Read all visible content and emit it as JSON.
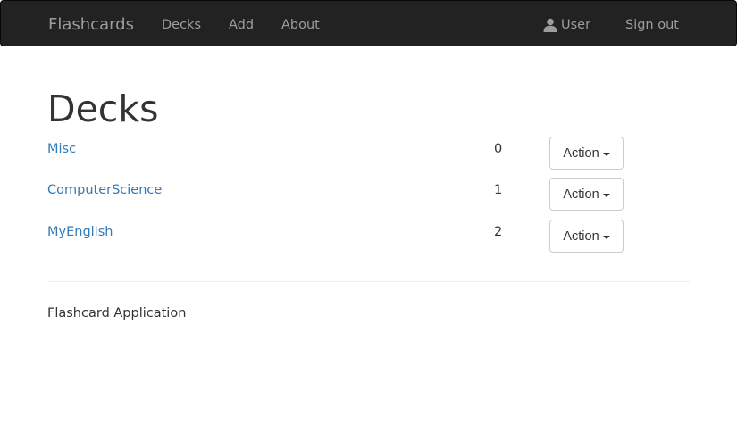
{
  "navbar": {
    "brand": "Flashcards",
    "links": [
      "Decks",
      "Add",
      "About"
    ],
    "user_label": "User",
    "signout_label": "Sign out",
    "icons": {
      "user": "user-icon"
    }
  },
  "page": {
    "title": "Decks",
    "footer": "Flashcard Application"
  },
  "decks": [
    {
      "name": "Misc",
      "count": "0",
      "action": "Action"
    },
    {
      "name": "ComputerScience",
      "count": "1",
      "action": "Action"
    },
    {
      "name": "MyEnglish",
      "count": "2",
      "action": "Action"
    }
  ],
  "colors": {
    "navbar_bg": "#222222",
    "nav_text": "#9d9d9d",
    "link": "#337ab7",
    "text": "#333333"
  }
}
